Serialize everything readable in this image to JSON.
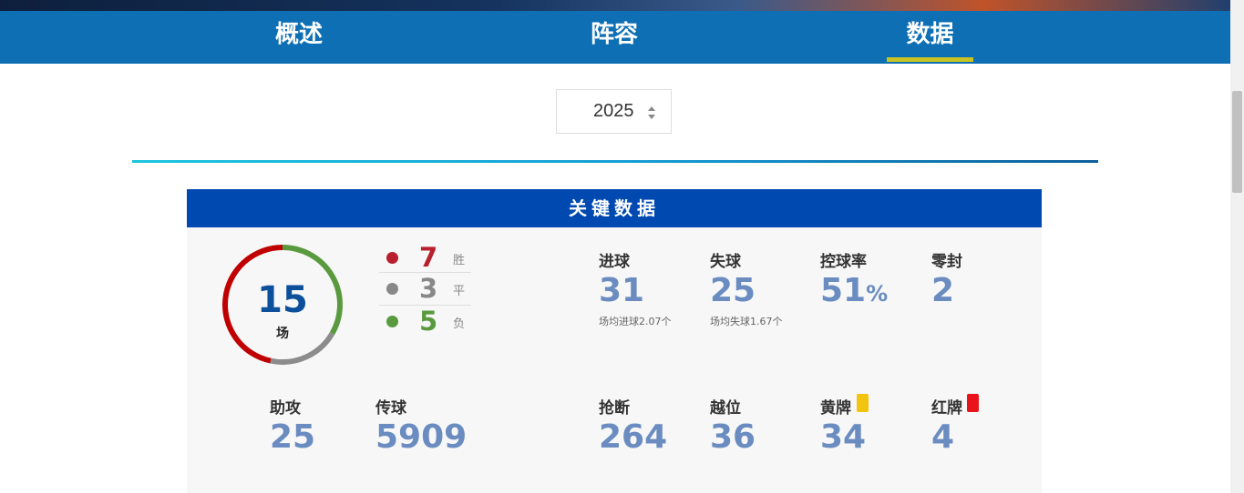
{
  "tabs": [
    {
      "label": "概述"
    },
    {
      "label": "阵容"
    },
    {
      "label": "数据",
      "active": true
    }
  ],
  "season_select": {
    "value": "2025"
  },
  "section_title": "关键数据",
  "matches": {
    "total": "15",
    "unit": "场",
    "win": 7,
    "draw": 3,
    "loss": 5
  },
  "record": [
    {
      "value": "7",
      "label": "胜",
      "color": "#b8202e"
    },
    {
      "value": "3",
      "label": "平",
      "color": "#888888"
    },
    {
      "value": "5",
      "label": "负",
      "color": "#5a9a3e"
    }
  ],
  "stats_top": [
    {
      "label": "进球",
      "value": "31",
      "note": "场均进球2.07个"
    },
    {
      "label": "失球",
      "value": "25",
      "note": "场均失球1.67个"
    },
    {
      "label": "控球率",
      "value": "51",
      "suffix": "%"
    },
    {
      "label": "零封",
      "value": "2"
    }
  ],
  "stats_bottom": [
    {
      "label": "助攻",
      "value": "25"
    },
    {
      "label": "传球",
      "value": "5909"
    },
    {
      "label": "抢断",
      "value": "264"
    },
    {
      "label": "越位",
      "value": "36"
    },
    {
      "label": "黄牌",
      "value": "34",
      "card_color": "#f2c40f"
    },
    {
      "label": "红牌",
      "value": "4",
      "card_color": "#e8131b"
    }
  ],
  "colors": {
    "tab_bar": "#0e6fb4",
    "tab_active_underline": "#c9c322",
    "panel_header": "#0049b1",
    "value_blue": "#6a8cc0",
    "ring_win": "#c00000",
    "ring_draw": "#8c8c8c",
    "ring_loss": "#5a9a3e"
  }
}
